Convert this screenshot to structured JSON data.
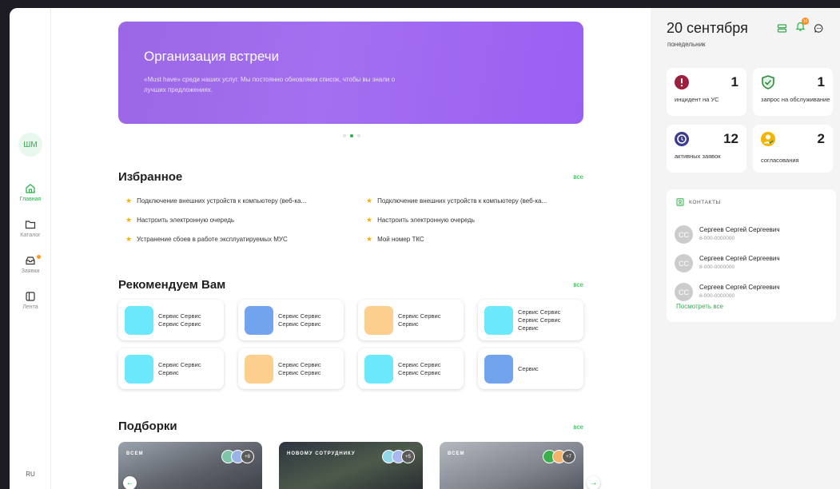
{
  "sidebar": {
    "avatar_initials": "ШМ",
    "items": [
      {
        "label": "Главная",
        "icon": "home-icon",
        "active": true
      },
      {
        "label": "Каталог",
        "icon": "folder-icon",
        "active": false
      },
      {
        "label": "Заявки",
        "icon": "inbox-icon",
        "active": false,
        "has_dot": true
      },
      {
        "label": "Лента",
        "icon": "sidebar-panel-icon",
        "active": false
      }
    ],
    "language": "RU"
  },
  "banner": {
    "title": "Организация встречи",
    "text": "«Must have» среди наших услуг. Мы постоянно обновляем список, чтобы вы знали о лучших предложениях.",
    "slides": 3,
    "active_slide": 2
  },
  "favorites": {
    "title": "Избранное",
    "all_label": "все",
    "left": [
      "Подключение внешних устройств к компьютеру (веб-ка...",
      "Настроить электронную очередь",
      "Устранение сбоев в работе эксплуатируемых МУС"
    ],
    "right": [
      "Подключение внешних устройств к компьютеру (веб-ка...",
      "Настроить электронную очередь",
      "Мой номер ТКС"
    ]
  },
  "recommended": {
    "title": "Рекомендуем Вам",
    "all_label": "все",
    "cards": [
      {
        "label": "Сервис Сервис Сервис Сервис",
        "color": "#6be8fb"
      },
      {
        "label": "Сервис Сервис Сервис Сервис",
        "color": "#72a4ee"
      },
      {
        "label": "Сервис Сервис Сервис",
        "color": "#fdcf8f"
      },
      {
        "label": "Сервис Сервис Сервис Сервис Сервис",
        "color": "#6be8fb"
      },
      {
        "label": "Сервис Сервис Сервис",
        "color": "#6be8fb"
      },
      {
        "label": "Сервис Сервис Сервис Сервис",
        "color": "#fdcf8f"
      },
      {
        "label": "Сервис Сервис Сервис Сервис",
        "color": "#6be8fb"
      },
      {
        "label": "Сервис",
        "color": "#72a4ee"
      }
    ]
  },
  "collections": {
    "title": "Подборки",
    "all_label": "все",
    "cards": [
      {
        "tag": "ВСЕМ",
        "count": "+8",
        "bg": "#6b6f78"
      },
      {
        "tag": "НОВОМУ СОТРУДНИКУ",
        "count": "+5",
        "bg": "#3e4450"
      },
      {
        "tag": "ВСЕМ",
        "count": "+7",
        "bg": "#8a8e96"
      }
    ]
  },
  "right_panel": {
    "date": "20 сентября",
    "weekday": "понедельник",
    "notification_count": "10",
    "stats": [
      {
        "value": "1",
        "label": "инцидент на УС",
        "icon": "alert-icon",
        "color": "#9c1f3f"
      },
      {
        "value": "1",
        "label": "запрос на обслуживание",
        "icon": "shield-check-icon",
        "color": "#2e8b3e"
      },
      {
        "value": "12",
        "label": "активных заявок",
        "icon": "clock-icon",
        "color": "#3b3b8f"
      },
      {
        "value": "2",
        "label": "согласования",
        "icon": "approval-icon",
        "color": "#f4b400"
      }
    ],
    "contacts": {
      "title": "КОНТАКТЫ",
      "items": [
        {
          "initials": "СС",
          "name": "Сергеев Сергей Сергеевич",
          "phone": "8-000-0000000"
        },
        {
          "initials": "СС",
          "name": "Сергеев Сергей Сергеевич",
          "phone": "8-000-0000000"
        },
        {
          "initials": "СС",
          "name": "Сергеев Сергей Сергеевич",
          "phone": "8-000-0000000"
        }
      ],
      "see_all": "Посмотреть все"
    }
  },
  "colors": {
    "accent": "#2db04c",
    "banner": "#9b67e6",
    "panel_bg": "#f4f4f5"
  }
}
